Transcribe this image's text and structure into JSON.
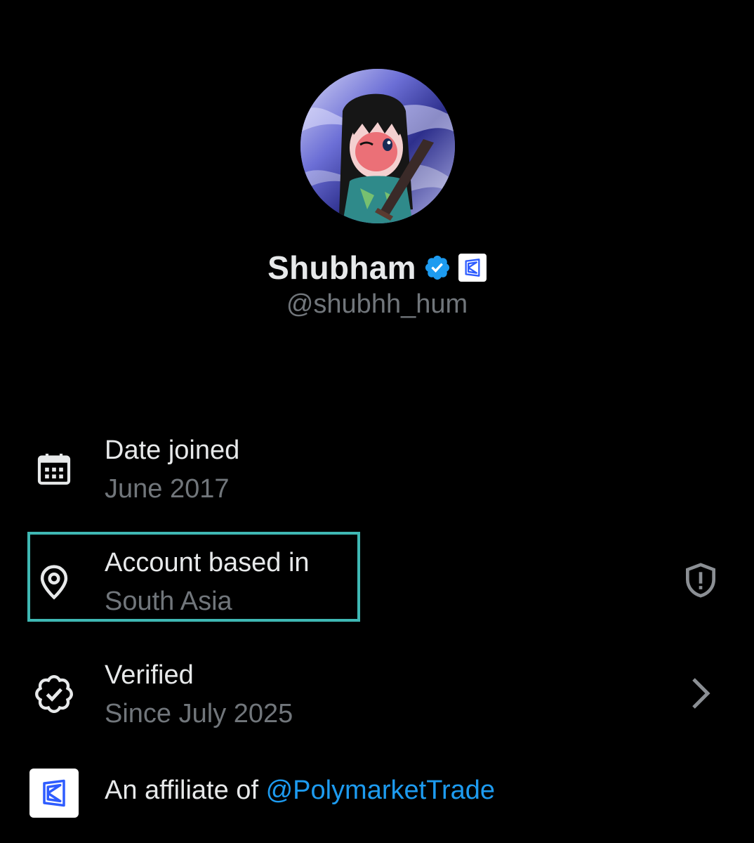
{
  "profile": {
    "display_name": "Shubham",
    "handle": "@shubhh_hum",
    "avatar_icon": "anime-avatar-image",
    "verified_icon": "verified-badge-icon",
    "affiliate_badge_icon": "polymarket-logo-icon"
  },
  "info": {
    "date_joined": {
      "icon": "calendar-icon",
      "title": "Date joined",
      "value": "June 2017"
    },
    "account_based_in": {
      "icon": "location-pin-icon",
      "title": "Account based in",
      "value": "South Asia",
      "right_icon": "shield-alert-icon"
    },
    "verified": {
      "icon": "verified-check-icon",
      "title": "Verified",
      "value": "Since July 2025",
      "right_icon": "chevron-right-icon"
    },
    "affiliate": {
      "icon": "polymarket-logo-icon",
      "prefix": "An affiliate of ",
      "link": "@PolymarketTrade"
    }
  },
  "colors": {
    "background": "#000000",
    "primary_text": "#e7e9ea",
    "secondary_text": "#71767b",
    "link": "#1d9bf0",
    "verified_blue": "#1d9bf0",
    "highlight_border": "#3fb8b4"
  }
}
